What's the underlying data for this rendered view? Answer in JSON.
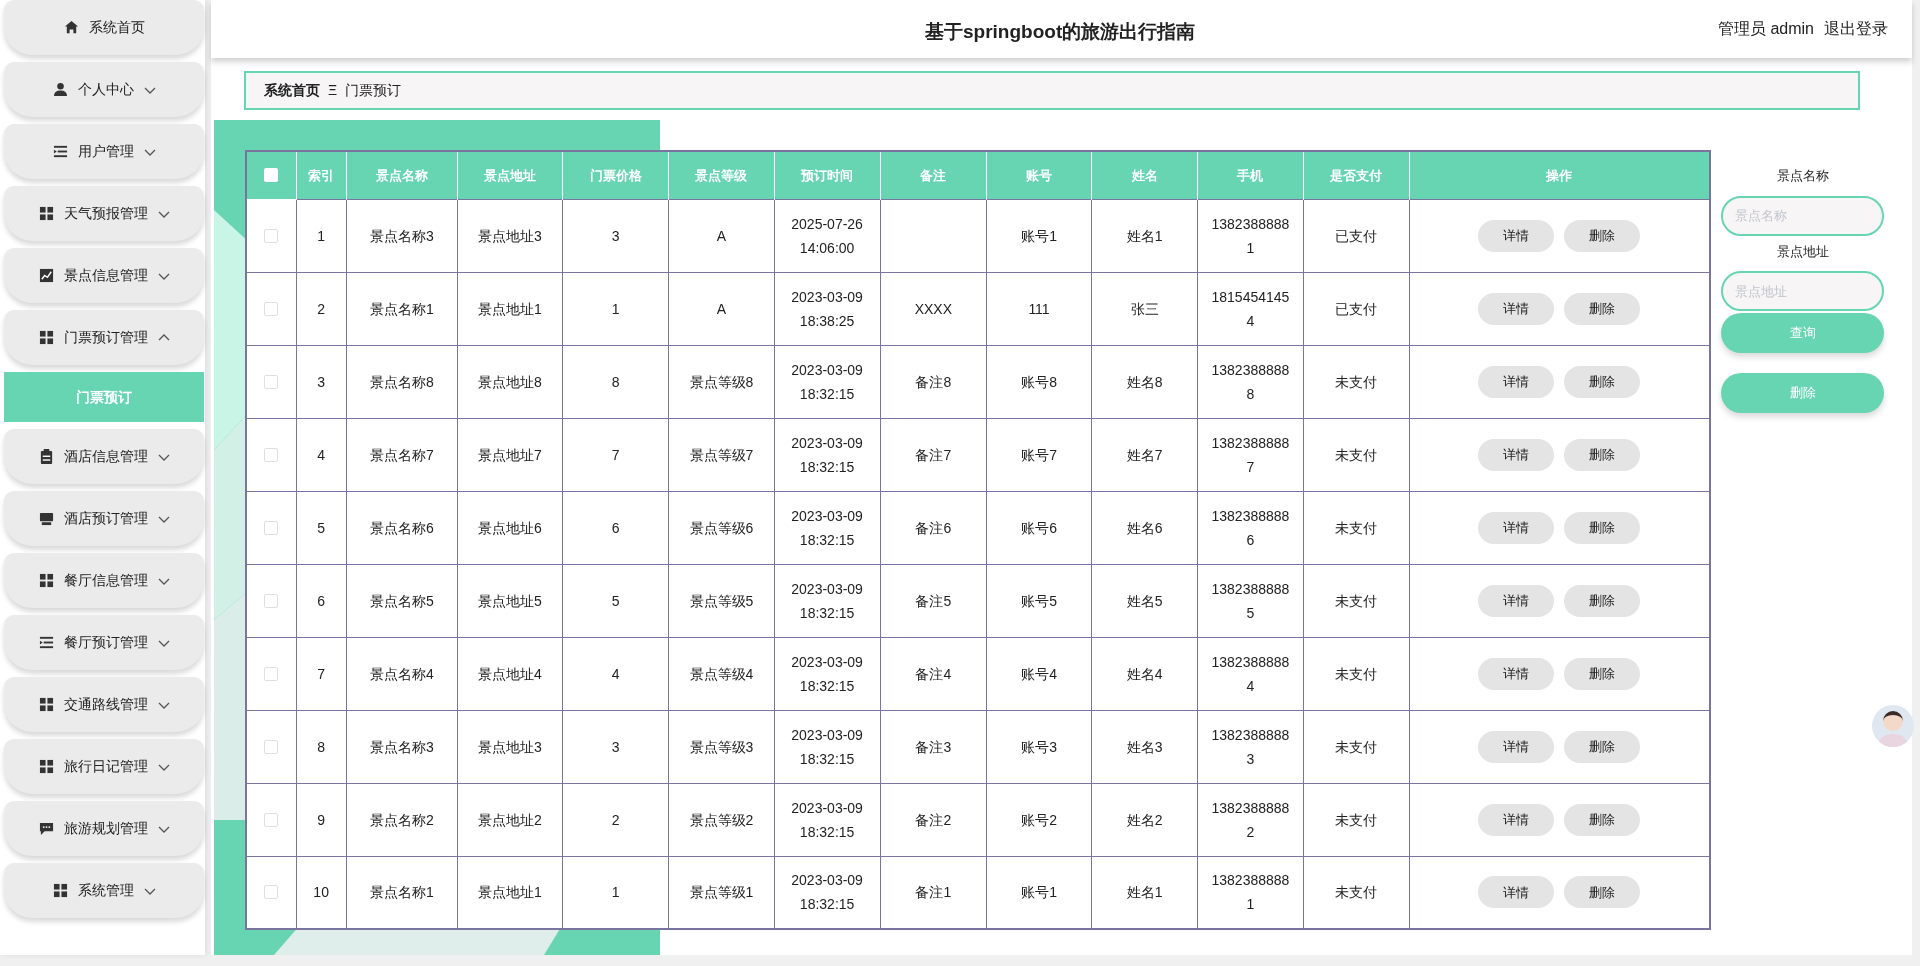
{
  "sidebar": {
    "items": [
      {
        "label": "系统首页",
        "kind": "link"
      },
      {
        "label": "个人中心",
        "kind": "menu",
        "expanded": false
      },
      {
        "label": "用户管理",
        "kind": "menu",
        "expanded": false
      },
      {
        "label": "天气预报管理",
        "kind": "menu",
        "expanded": false
      },
      {
        "label": "景点信息管理",
        "kind": "menu",
        "expanded": false
      },
      {
        "label": "门票预订管理",
        "kind": "menu",
        "expanded": true,
        "children": [
          {
            "label": "门票预订",
            "selected": true
          }
        ]
      },
      {
        "label": "酒店信息管理",
        "kind": "menu",
        "expanded": false
      },
      {
        "label": "酒店预订管理",
        "kind": "menu",
        "expanded": false
      },
      {
        "label": "餐厅信息管理",
        "kind": "menu",
        "expanded": false
      },
      {
        "label": "餐厅预订管理",
        "kind": "menu",
        "expanded": false
      },
      {
        "label": "交通路线管理",
        "kind": "menu",
        "expanded": false
      },
      {
        "label": "旅行日记管理",
        "kind": "menu",
        "expanded": false
      },
      {
        "label": "旅游规划管理",
        "kind": "menu",
        "expanded": false
      },
      {
        "label": "系统管理",
        "kind": "menu",
        "expanded": false
      }
    ]
  },
  "header": {
    "title": "基于springboot的旅游出行指南",
    "user": "管理员 admin",
    "logout": "退出登录"
  },
  "breadcrumb": {
    "home": "系统首页",
    "separator": "Ξ",
    "current": "门票预订"
  },
  "table": {
    "select_all": false,
    "columns": [
      "索引",
      "景点名称",
      "景点地址",
      "门票价格",
      "景点等级",
      "预订时间",
      "备注",
      "账号",
      "姓名",
      "手机",
      "是否支付",
      "操作"
    ],
    "rows": [
      {
        "checked": false,
        "cells": [
          "1",
          "景点名称3",
          "景点地址3",
          "3",
          "A",
          "2025-07-26 14:06:00",
          "",
          "账号1",
          "姓名1",
          "13823888881",
          "已支付"
        ],
        "actions": [
          "详情",
          "删除"
        ]
      },
      {
        "checked": false,
        "cells": [
          "2",
          "景点名称1",
          "景点地址1",
          "1",
          "A",
          "2023-03-09 18:38:25",
          "XXXX",
          "111",
          "张三",
          "18154541454",
          "已支付"
        ],
        "actions": [
          "详情",
          "删除"
        ]
      },
      {
        "checked": false,
        "cells": [
          "3",
          "景点名称8",
          "景点地址8",
          "8",
          "景点等级8",
          "2023-03-09 18:32:15",
          "备注8",
          "账号8",
          "姓名8",
          "13823888888",
          "未支付"
        ],
        "actions": [
          "详情",
          "删除"
        ]
      },
      {
        "checked": false,
        "cells": [
          "4",
          "景点名称7",
          "景点地址7",
          "7",
          "景点等级7",
          "2023-03-09 18:32:15",
          "备注7",
          "账号7",
          "姓名7",
          "13823888887",
          "未支付"
        ],
        "actions": [
          "详情",
          "删除"
        ]
      },
      {
        "checked": false,
        "cells": [
          "5",
          "景点名称6",
          "景点地址6",
          "6",
          "景点等级6",
          "2023-03-09 18:32:15",
          "备注6",
          "账号6",
          "姓名6",
          "13823888886",
          "未支付"
        ],
        "actions": [
          "详情",
          "删除"
        ]
      },
      {
        "checked": false,
        "cells": [
          "6",
          "景点名称5",
          "景点地址5",
          "5",
          "景点等级5",
          "2023-03-09 18:32:15",
          "备注5",
          "账号5",
          "姓名5",
          "13823888885",
          "未支付"
        ],
        "actions": [
          "详情",
          "删除"
        ]
      },
      {
        "checked": false,
        "cells": [
          "7",
          "景点名称4",
          "景点地址4",
          "4",
          "景点等级4",
          "2023-03-09 18:32:15",
          "备注4",
          "账号4",
          "姓名4",
          "13823888884",
          "未支付"
        ],
        "actions": [
          "详情",
          "删除"
        ]
      },
      {
        "checked": false,
        "cells": [
          "8",
          "景点名称3",
          "景点地址3",
          "3",
          "景点等级3",
          "2023-03-09 18:32:15",
          "备注3",
          "账号3",
          "姓名3",
          "13823888883",
          "未支付"
        ],
        "actions": [
          "详情",
          "删除"
        ]
      },
      {
        "checked": false,
        "cells": [
          "9",
          "景点名称2",
          "景点地址2",
          "2",
          "景点等级2",
          "2023-03-09 18:32:15",
          "备注2",
          "账号2",
          "姓名2",
          "13823888882",
          "未支付"
        ],
        "actions": [
          "详情",
          "删除"
        ]
      },
      {
        "checked": false,
        "cells": [
          "10",
          "景点名称1",
          "景点地址1",
          "1",
          "景点等级1",
          "2023-03-09 18:32:15",
          "备注1",
          "账号1",
          "姓名1",
          "13823888881",
          "未支付"
        ],
        "actions": [
          "详情",
          "删除"
        ]
      }
    ]
  },
  "search": {
    "fields": [
      {
        "label": "景点名称",
        "placeholder": "景点名称"
      },
      {
        "label": "景点地址",
        "placeholder": "景点地址"
      }
    ],
    "query_button": "查询",
    "delete_button": "删除"
  }
}
